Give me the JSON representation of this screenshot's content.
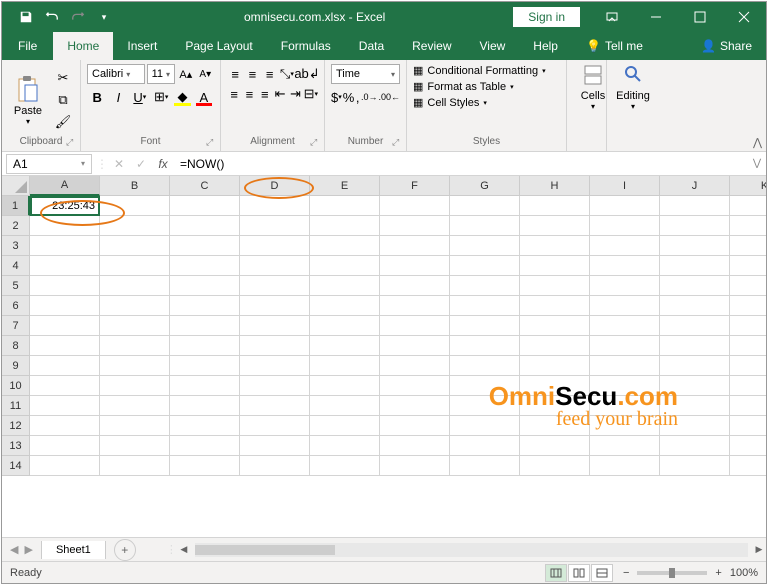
{
  "title": "omnisecu.com.xlsx - Excel",
  "signin": "Sign in",
  "menu": {
    "file": "File",
    "home": "Home",
    "insert": "Insert",
    "pagelayout": "Page Layout",
    "formulas": "Formulas",
    "data": "Data",
    "review": "Review",
    "view": "View",
    "help": "Help",
    "tellme": "Tell me",
    "share": "Share"
  },
  "ribbon": {
    "clipboard": {
      "paste": "Paste",
      "label": "Clipboard"
    },
    "font": {
      "name": "Calibri",
      "size": "11",
      "label": "Font"
    },
    "alignment": {
      "label": "Alignment"
    },
    "number": {
      "format": "Time",
      "label": "Number"
    },
    "styles": {
      "conditional": "Conditional Formatting",
      "table": "Format as Table",
      "cellstyles": "Cell Styles",
      "label": "Styles"
    },
    "cells": {
      "label": "Cells"
    },
    "editing": {
      "label": "Editing"
    }
  },
  "namebox": "A1",
  "formula": "=NOW()",
  "columns": [
    "A",
    "B",
    "C",
    "D",
    "E",
    "F",
    "G",
    "H",
    "I",
    "J",
    "K"
  ],
  "rows": [
    "1",
    "2",
    "3",
    "4",
    "5",
    "6",
    "7",
    "8",
    "9",
    "10",
    "11",
    "12",
    "13",
    "14"
  ],
  "cell_a1": "23:25:43",
  "sheet": "Sheet1",
  "status": "Ready",
  "zoom": "100%",
  "watermark": {
    "part1": "Omni",
    "part2": "Secu",
    "part3": ".com",
    "sub": "feed your brain"
  }
}
